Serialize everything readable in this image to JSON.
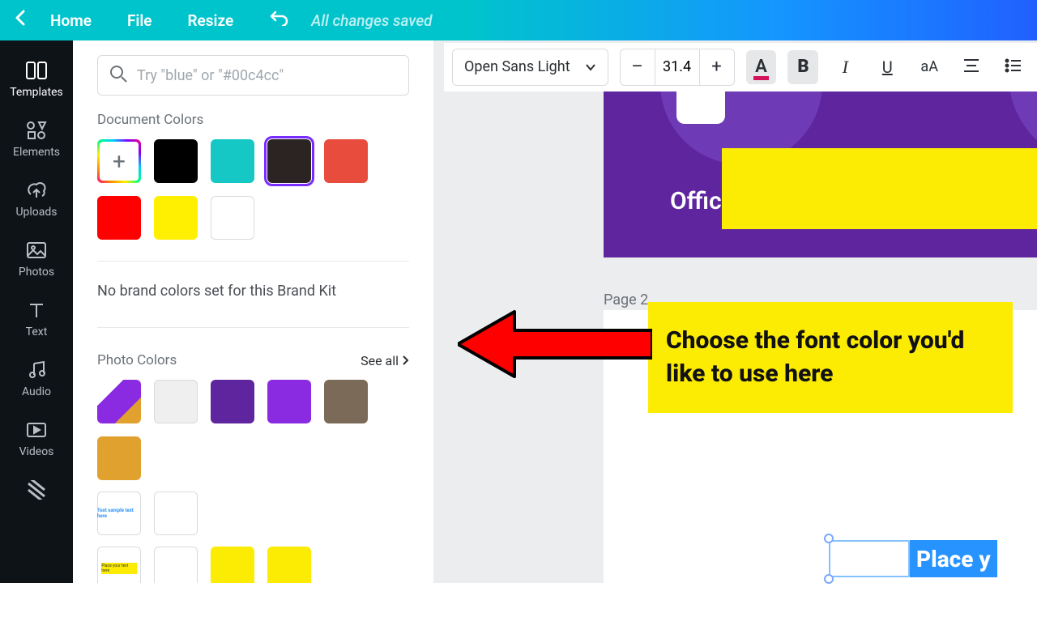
{
  "header": {
    "home": "Home",
    "file": "File",
    "resize": "Resize",
    "saved": "All changes saved"
  },
  "rail": {
    "templates": "Templates",
    "elements": "Elements",
    "uploads": "Uploads",
    "photos": "Photos",
    "text": "Text",
    "audio": "Audio",
    "videos": "Videos"
  },
  "panel": {
    "search_placeholder": "Try \"blue\" or \"#00c4cc\"",
    "doc_colors_label": "Document Colors",
    "brand_msg": "No brand colors set for this Brand Kit",
    "photo_colors_label": "Photo Colors",
    "see_all": "See all",
    "doc_colors": [
      {
        "type": "add"
      },
      {
        "hex": "#000000"
      },
      {
        "hex": "#15c8c6"
      },
      {
        "hex": "#2c2423",
        "selected": true
      },
      {
        "hex": "#e74c3c"
      },
      {
        "hex": "#ff0000"
      },
      {
        "hex": "#ffef00"
      },
      {
        "hex": "#ffffff",
        "white": true
      }
    ],
    "photo_colors_row1": [
      {
        "kind": "thumb-purple"
      },
      {
        "hex": "#efefef",
        "white": true
      },
      {
        "hex": "#5f259f"
      },
      {
        "hex": "#8a2be2"
      },
      {
        "hex": "#7a6a57"
      },
      {
        "hex": "#e0a12f"
      }
    ],
    "photo_colors_row2": [
      {
        "kind": "thumb-text"
      },
      {
        "hex": "#ffffff",
        "white": true
      }
    ],
    "photo_colors_row3": [
      {
        "kind": "thumb-yellow"
      },
      {
        "hex": "#ffffff",
        "white": true
      },
      {
        "hex": "#fcec03"
      },
      {
        "hex": "#fcec03"
      }
    ]
  },
  "toolbar": {
    "font": "Open Sans Light",
    "size": "31.4"
  },
  "canvas": {
    "offic_text": "Offic",
    "page_label": "Page 2",
    "selected_text": "Place y"
  },
  "annotation": {
    "callout": "Choose the font color you'd like to use here"
  }
}
